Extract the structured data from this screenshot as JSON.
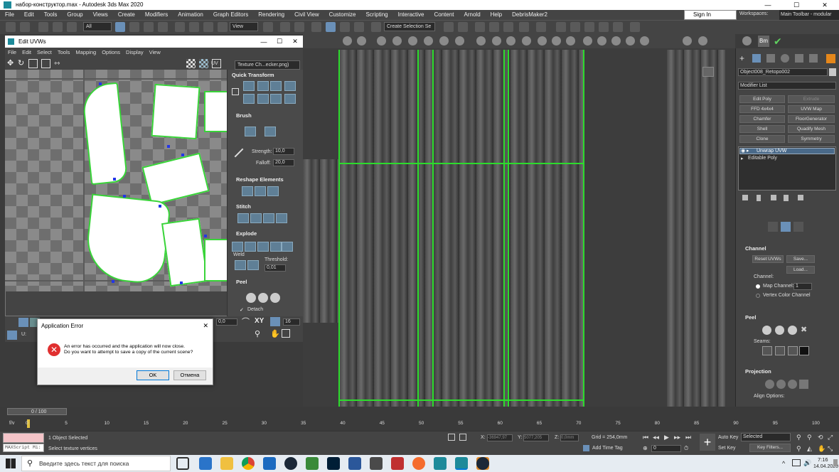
{
  "window": {
    "title": "набор-конструктор.max - Autodesk 3ds Max 2020",
    "min": "—",
    "max": "☐",
    "close": "✕"
  },
  "menu": [
    "File",
    "Edit",
    "Tools",
    "Group",
    "Views",
    "Create",
    "Modifiers",
    "Animation",
    "Graph Editors",
    "Rendering",
    "Civil View",
    "Customize",
    "Scripting",
    "Interactive",
    "Content",
    "Arnold",
    "Help",
    "DebrisMaker2"
  ],
  "account": {
    "signin": "Sign In",
    "workspaces_label": "Workspaces:",
    "workspace": "Main Toolbar - modular"
  },
  "toolbar": {
    "filter": "All",
    "view": "View",
    "selection_set": "Create Selection Se"
  },
  "uvw": {
    "title": "Edit UVWs",
    "menu": [
      "File",
      "Edit",
      "Select",
      "Tools",
      "Mapping",
      "Options",
      "Display",
      "View"
    ],
    "uv_label": "UV",
    "texture": "Texture Ch...ecker.png)",
    "quick_transform": "Quick Transform",
    "brush": "Brush",
    "strength_label": "Strength:",
    "strength": "10,0",
    "falloff_label": "Falloff:",
    "falloff": "20,0",
    "reshape": "Reshape Elements",
    "stitch": "Stitch",
    "explode": "Explode",
    "weld": "Weld",
    "threshold_label": "Threshold:",
    "threshold": "0,01",
    "peel": "Peel",
    "detach": "Detach",
    "u_label": "U:",
    "val_a": "0,0",
    "xy": "XY",
    "val_b": "16"
  },
  "dialog": {
    "title": "Application Error",
    "line1": "An error has occurred and the application will now close.",
    "line2": "Do you want to attempt to save a copy of the current scene?",
    "ok": "OK",
    "cancel": "Отмена"
  },
  "cmd": {
    "object": "Object008_Retopo002",
    "modifier_list": "Modifier List",
    "buttons": [
      "Edit Poly",
      "Extrude",
      "FFD 4x4x4",
      "UVW Map",
      "Chamfer",
      "FloorGenerator",
      "Shell",
      "Quadify Mesh",
      "Clone",
      "Symmetry"
    ],
    "stack": [
      "Unwrap UVW",
      "Editable Poly"
    ],
    "channel": "Channel",
    "reset_uvws": "Reset UVWs",
    "save": "Save...",
    "load": "Load...",
    "channel_label": "Channel:",
    "map_channel": "Map Channel:",
    "map_channel_val": "1",
    "vertex_color": "Vertex Color Channel",
    "peel": "Peel",
    "seams": "Seams:",
    "projection": "Projection",
    "align": "Align Options:"
  },
  "timeline": {
    "frame": "0 / 100",
    "ticks": [
      "0",
      "5",
      "10",
      "15",
      "20",
      "25",
      "30",
      "35",
      "40",
      "45",
      "50",
      "55",
      "60",
      "65",
      "70",
      "75",
      "80",
      "85",
      "90",
      "95",
      "100"
    ]
  },
  "status": {
    "maxscript": "MAXScript Mi:",
    "selected": "1 Object Selected",
    "prompt": "Select texture vertices",
    "x_label": "X:",
    "x": "-36947,97",
    "y_label": "Y:",
    "y": "5077,205",
    "z_label": "Z:",
    "z": "0,0mm",
    "grid": "Grid = 254,0mm",
    "add_time_tag": "Add Time Tag",
    "auto_key": "Auto Key",
    "set_key": "Set Key",
    "selected_dd": "Selected",
    "key_filters": "Key Filters...",
    "frame_val": "0"
  },
  "taskbar": {
    "search": "Введите здесь текст для поиска",
    "time": "7:16",
    "date": "14.04.2020"
  }
}
